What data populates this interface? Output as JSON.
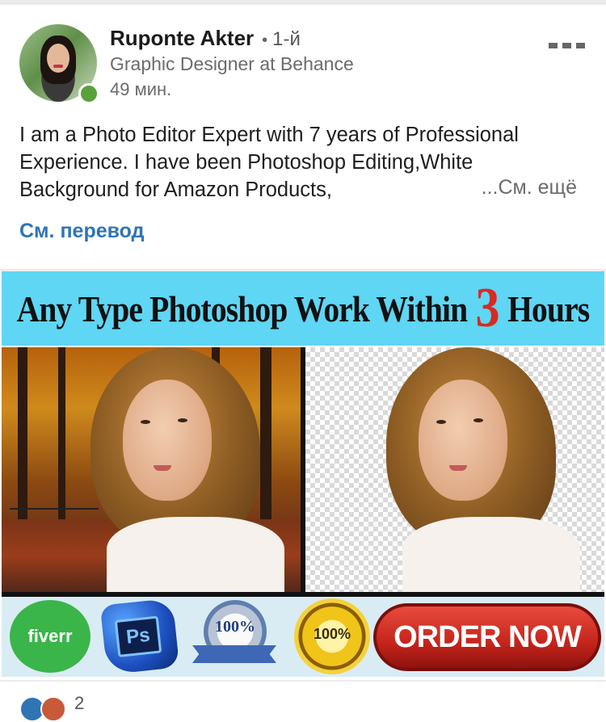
{
  "post": {
    "author": {
      "name": "Ruponte Akter",
      "degree": "1-й",
      "headline": "Graphic Designer at Behance",
      "time": "49 мин."
    },
    "text_lines": [
      "I am a Photo Editor Expert with 7 years of Professional",
      "Experience. I have been Photoshop Editing,White",
      "Background for Amazon Products,"
    ],
    "see_more": "...См. ещё",
    "translate": "См. перевод",
    "reaction_count": "2"
  },
  "banner": {
    "title_start": "Any Type Photoshop Work Within",
    "title_number": "3",
    "title_end": "Hours",
    "fiverr": "fiverr",
    "ps": "Ps",
    "satisfaction_pct": "100%",
    "moneyback_pct": "100%",
    "order_now": "ORDER NOW"
  },
  "colors": {
    "link": "#2f75b4",
    "online": "#57a23a",
    "banner_band": "#5fd6f4",
    "order_button": "#c4241b"
  }
}
